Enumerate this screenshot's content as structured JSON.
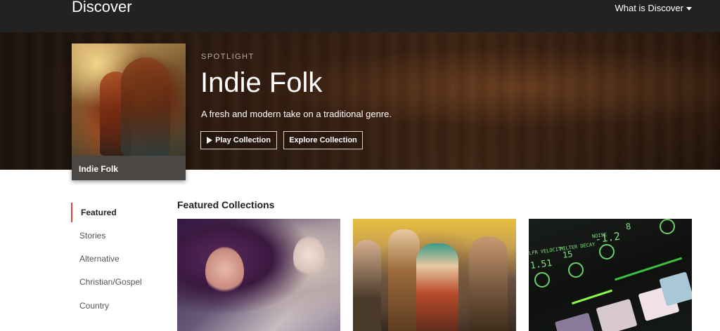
{
  "header": {
    "brand": "Discover",
    "menu_label": "What is Discover"
  },
  "spotlight": {
    "kicker": "SPOTLIGHT",
    "title": "Indie Folk",
    "description": "A fresh and modern take on a traditional genre.",
    "cover_label": "Indie Folk",
    "play_label": "Play Collection",
    "explore_label": "Explore Collection"
  },
  "sidebar": {
    "items": [
      {
        "label": "Featured",
        "active": true
      },
      {
        "label": "Stories",
        "active": false
      },
      {
        "label": "Alternative",
        "active": false
      },
      {
        "label": "Christian/Gospel",
        "active": false
      },
      {
        "label": "Country",
        "active": false
      }
    ]
  },
  "main": {
    "section_title": "Featured Collections"
  },
  "device_screen": {
    "labels": [
      "LFR VELOCITY",
      "FILTER DECAY",
      "NOISE",
      "1.51",
      "15",
      "-1.2",
      "8"
    ]
  },
  "colors": {
    "topbar_bg": "#222222",
    "accent": "#e34234",
    "card_label_bg": "#4a4744"
  }
}
